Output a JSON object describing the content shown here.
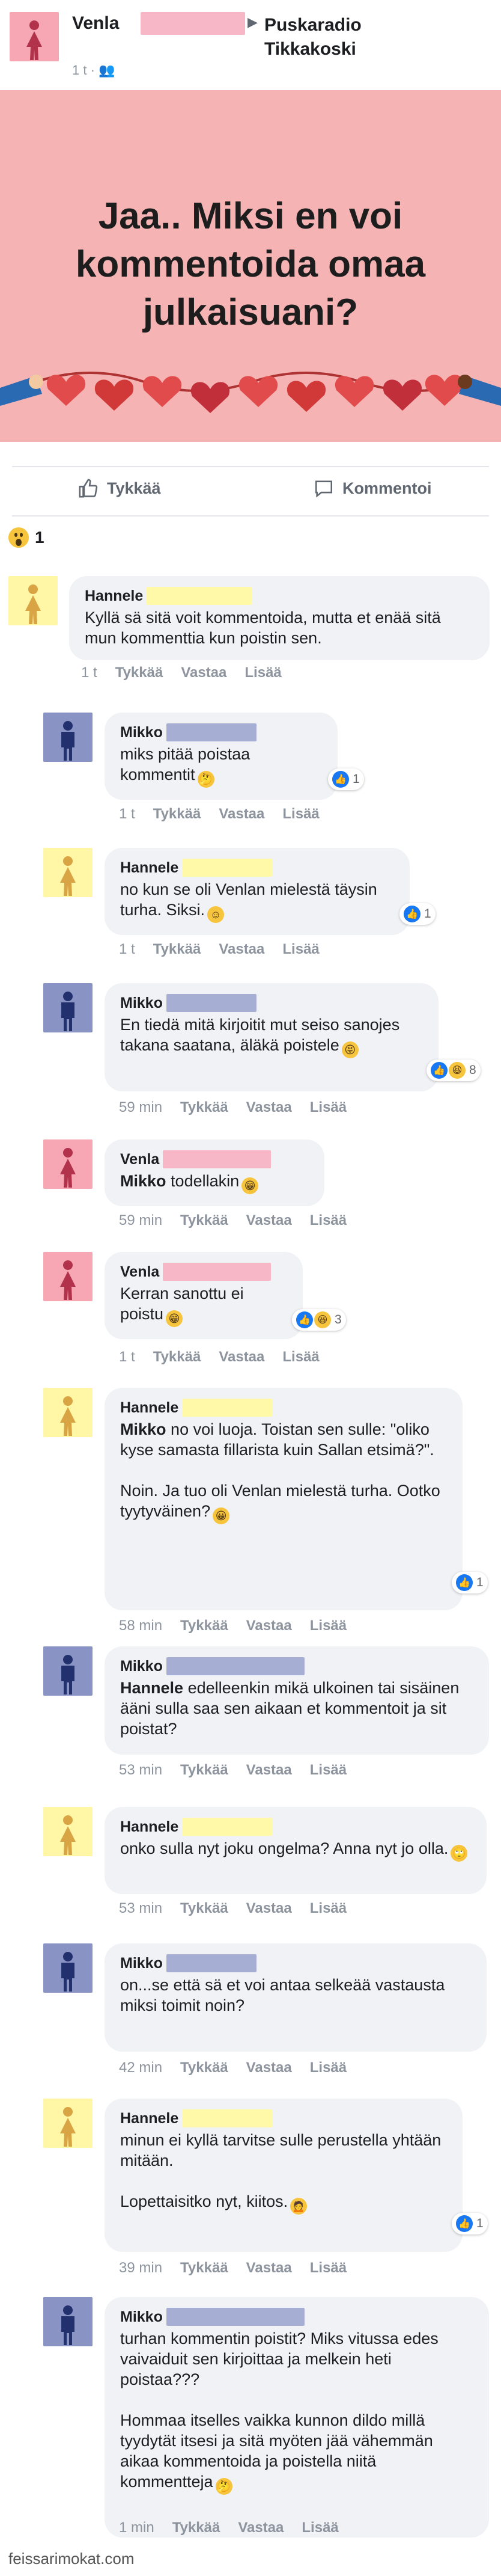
{
  "post": {
    "author": "Venla",
    "arrow": "▶",
    "page": "Puskaradio Tikkakoski",
    "meta": "1 t · 👥",
    "banner_title": "Jaa.. Miksi en voi kommentoida omaa julkaisuani?",
    "like_label": "Tykkää",
    "comment_label": "Kommentoi",
    "reaction_count": "1"
  },
  "comment_actions": {
    "like": "Tykkää",
    "reply": "Vastaa",
    "more": "Lisää"
  },
  "comments": [
    {
      "name": "Hannele",
      "text": "Kyllä sä sitä voit kommentoida, mutta et enää sitä mun kommenttia kun poistin sen.",
      "time": "1 t"
    },
    {
      "name": "Mikko",
      "text": "miks pitää poistaa kommentit",
      "time": "1 t",
      "reactions": "1"
    },
    {
      "name": "Hannele",
      "text": "no kun se oli Venlan mielestä täysin turha. Siksi.",
      "time": "1 t",
      "reactions": "1"
    },
    {
      "name": "Mikko",
      "text": "En tiedä mitä kirjoitit mut seiso sanojes takana saatana, äläkä poistele",
      "time": "59 min",
      "reactions": "8"
    },
    {
      "name": "Venla",
      "mention": "Mikko",
      "text": "todellakin",
      "time": "59 min"
    },
    {
      "name": "Venla",
      "text": "Kerran sanottu ei poistu",
      "time": "1 t",
      "reactions": "3"
    },
    {
      "name": "Hannele",
      "mention": "Mikko",
      "text": "no voi luoja. Toistan sen sulle: \"oliko kyse samasta fillarista kuin Sallan etsimä?\".\n\nNoin. Ja tuo oli Venlan mielestä turha. Ootko tyytyväinen?",
      "time": "58 min",
      "reactions": "1"
    },
    {
      "name": "Mikko",
      "mention": "Hannele",
      "text": "edelleenkin mikä ulkoinen tai sisäinen ääni sulla saa sen aikaan et kommentoit ja sit poistat?",
      "time": "53 min"
    },
    {
      "name": "Hannele",
      "text": "onko sulla nyt joku ongelma? Anna nyt jo olla.",
      "time": "53 min"
    },
    {
      "name": "Mikko",
      "text": "on...se että sä et voi antaa selkeää vastausta miksi toimit noin?",
      "time": "42 min"
    },
    {
      "name": "Hannele",
      "text": "minun ei kyllä tarvitse sulle perustella yhtään mitään.\n\nLopettaisitko nyt, kiitos.",
      "time": "39 min",
      "reactions": "1"
    },
    {
      "name": "Mikko",
      "text": "turhan kommentin poistit? Miks vitussa edes vaivaiduit sen kirjoittaa ja melkein heti poistaa???\n\nHommaa itselles vaikka kunnon dildo millä tyydytät itsesi ja sitä myöten jää vähemmän aikaa kommentoida ja poistella niitä kommentteja",
      "time": "1 min"
    }
  ],
  "watermark": "feissarimokat.com",
  "colors": {
    "pink": "#f6a7b3",
    "blue": "#8993c4",
    "yellow": "#fff6a6",
    "banner": "#f5b3b3",
    "bubble": "#f0f2f5"
  }
}
